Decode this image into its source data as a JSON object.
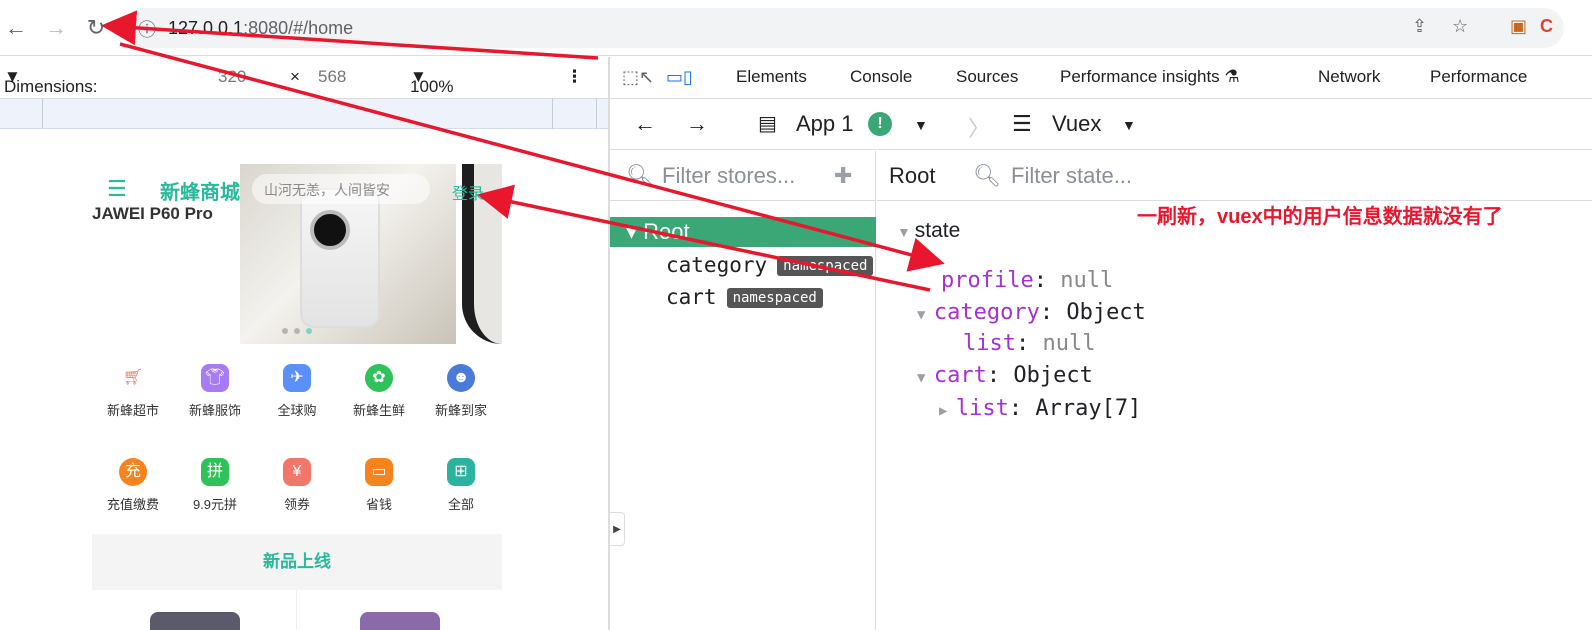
{
  "browser": {
    "url_host": "127.0.0.1",
    "url_path": ":8080/#/home"
  },
  "device_toolbar": {
    "dimensions_label": "Dimensions: iPho...",
    "width": "320",
    "times": "×",
    "height": "568",
    "zoom": "100%"
  },
  "devtools_tabs": [
    "Elements",
    "Console",
    "Sources",
    "Performance insights",
    "Network",
    "Performance"
  ],
  "vue_bar": {
    "app_label": "App 1",
    "store_label": "Vuex"
  },
  "left_pane": {
    "filter_placeholder": "Filter stores...",
    "root_label": "Root",
    "children": [
      {
        "name": "category",
        "badge": "namespaced"
      },
      {
        "name": "cart",
        "badge": "namespaced"
      }
    ]
  },
  "right_pane": {
    "breadcrumb": "Root",
    "filter_placeholder": "Filter state...",
    "state_label": "state",
    "tree": {
      "profile_key": "profile",
      "profile_val": "null",
      "category_key": "category",
      "category_val": "Object",
      "category_list_key": "list",
      "category_list_val": "null",
      "cart_key": "cart",
      "cart_val": "Object",
      "cart_list_key": "list",
      "cart_list_val": "Array[7]"
    }
  },
  "annotation": "一刷新，vuex中的用户信息数据就没有了",
  "shop": {
    "brand": "新蜂商城",
    "search_placeholder": "山河无恙，人间皆安",
    "login": "登录",
    "promo_title": "JAWEI P60 Pro",
    "categories_row1": [
      "新蜂超市",
      "新蜂服饰",
      "全球购",
      "新蜂生鲜",
      "新蜂到家"
    ],
    "categories_row2": [
      "充值缴费",
      "9.9元拼",
      "领券",
      "省钱",
      "全部"
    ],
    "new_arrivals": "新品上线"
  },
  "colors": {
    "brand": "#27ba9b",
    "annotation": "#e8172d",
    "root_row": "#3ba776"
  }
}
